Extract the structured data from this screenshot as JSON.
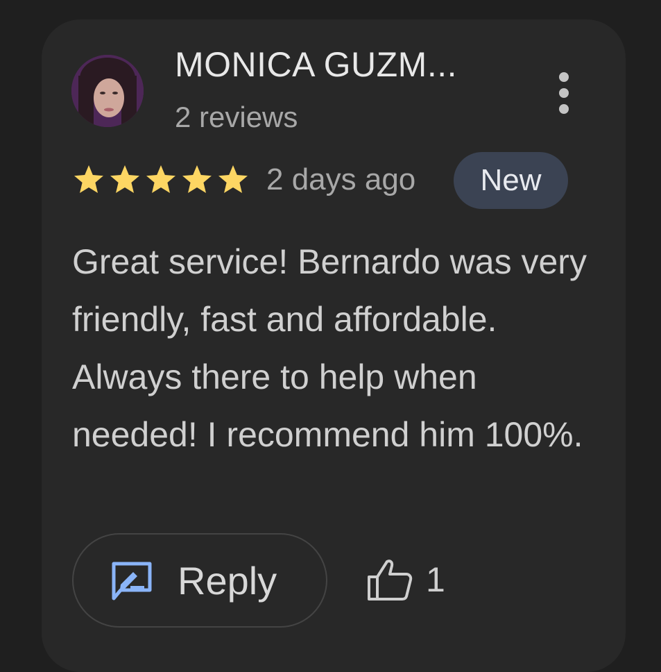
{
  "reviewer": {
    "name": "MONICA GUZM...",
    "review_count": "2 reviews"
  },
  "rating": {
    "stars": 5,
    "max_stars": 5,
    "star_color": "#fdd663"
  },
  "review": {
    "date": "2 days ago",
    "badge": "New",
    "text": "Great service! Bernardo was very friendly, fast and affordable. Always there to help when needed! I recommend him 100%."
  },
  "actions": {
    "reply_label": "Reply",
    "like_count": "1"
  },
  "icons": {
    "menu": "more-vert-icon",
    "reply": "reply-edit-icon",
    "like": "thumb-up-icon",
    "star": "star-icon"
  },
  "colors": {
    "background": "#1f1f1f",
    "card": "#282828",
    "badge_bg": "#3b4353",
    "reply_icon": "#8ab4f8"
  }
}
